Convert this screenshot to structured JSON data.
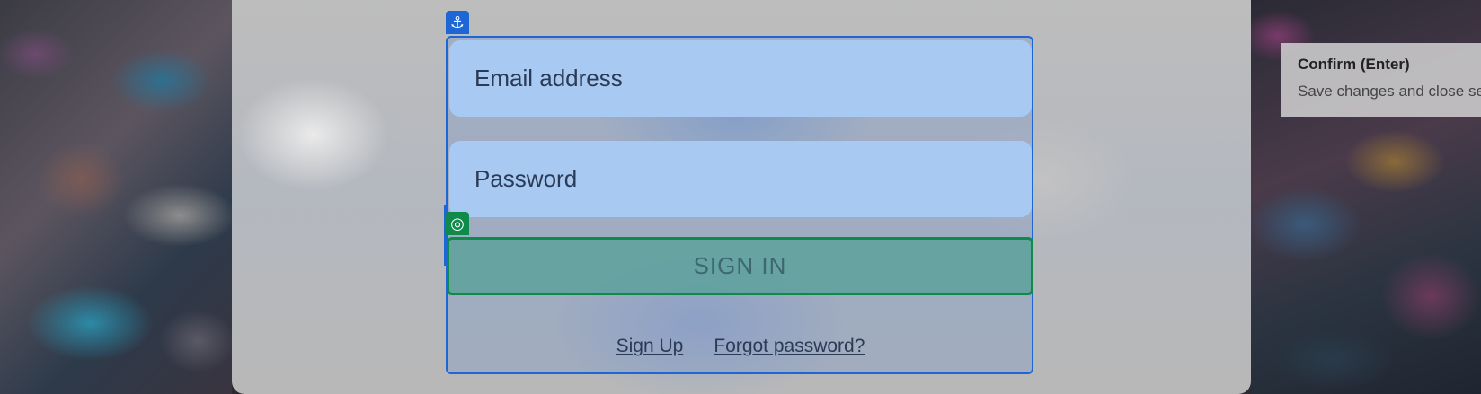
{
  "login": {
    "email_placeholder": "Email address",
    "password_placeholder": "Password",
    "signin_label": "SIGN IN",
    "signup_link": "Sign Up",
    "forgot_link": "Forgot password?"
  },
  "badges": {
    "anchor_icon": "anchor-icon",
    "target_icon": "target-icon"
  },
  "tooltip": {
    "title": "Confirm (Enter)",
    "description": "Save changes and close se"
  },
  "colors": {
    "selection_blue": "#1c66d6",
    "target_green": "#0e8a4a",
    "field_bg": "#a7c9f2"
  }
}
